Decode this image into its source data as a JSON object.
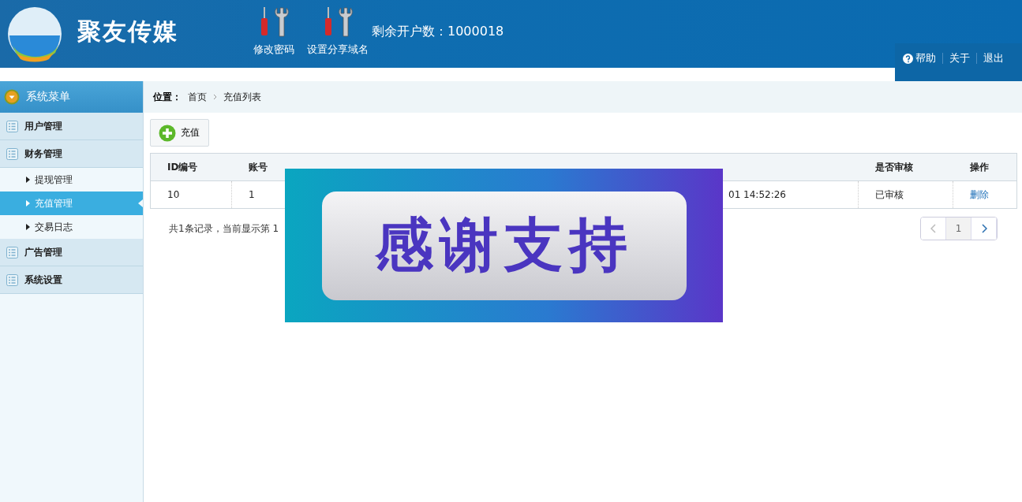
{
  "header": {
    "brand": "聚友传媒",
    "tools": [
      {
        "label": "修改密码"
      },
      {
        "label": "设置分享域名"
      }
    ],
    "accounts_left": "剩余开户数：1000018",
    "links": [
      {
        "label": "帮助",
        "kind": "help"
      },
      {
        "label": "关于",
        "kind": "plain"
      },
      {
        "label": "退出",
        "kind": "plain"
      }
    ]
  },
  "sidebar": {
    "title": "系统菜单",
    "items": [
      {
        "label": "用户管理"
      },
      {
        "label": "财务管理",
        "children": [
          {
            "label": "提现管理",
            "selected": false
          },
          {
            "label": "充值管理",
            "selected": true
          },
          {
            "label": "交易日志",
            "selected": false
          }
        ]
      },
      {
        "label": "广告管理"
      },
      {
        "label": "系统设置"
      }
    ]
  },
  "breadcrumb": {
    "label": "位置：",
    "items": [
      "首页",
      "充值列表"
    ]
  },
  "toolbar": {
    "add_button": "充值"
  },
  "table": {
    "columns": {
      "id": "ID编号",
      "account": "账号",
      "reviewed": "是否审核",
      "action": "操作"
    },
    "rows": [
      {
        "id": "10",
        "account": "1",
        "recharge_time": "01 14:52:26",
        "reviewed": "已审核",
        "action": "删除"
      }
    ]
  },
  "footer": {
    "summary": "共1条记录，当前显示第 1",
    "pages": [
      {
        "label": "1",
        "selected": true
      }
    ]
  },
  "overlay_banner": {
    "text": "感谢支持"
  }
}
